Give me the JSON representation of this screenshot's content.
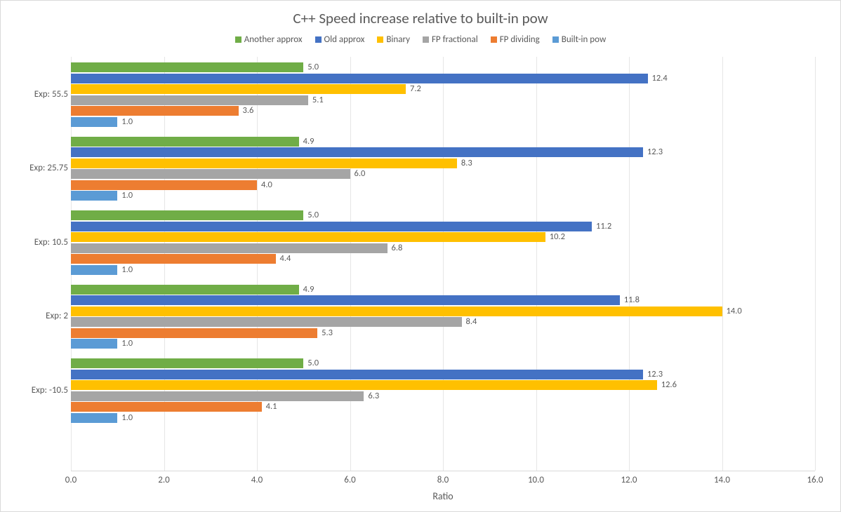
{
  "title": "C++ Speed increase relative to built-in pow",
  "xlabel": "Ratio",
  "legend_order": [
    "Another approx",
    "Old approx",
    "Binary",
    "FP fractional",
    "FP dividing",
    "Built-in pow"
  ],
  "chart_data": {
    "type": "bar",
    "orientation": "horizontal",
    "xlabel": "Ratio",
    "ylabel": "",
    "xlim": [
      0.0,
      16.0
    ],
    "xticks": [
      0.0,
      2.0,
      4.0,
      6.0,
      8.0,
      10.0,
      12.0,
      14.0,
      16.0
    ],
    "categories": [
      "Exp: -10.5",
      "Exp: 2",
      "Exp: 10.5",
      "Exp: 25.75",
      "Exp: 55.5"
    ],
    "series": [
      {
        "name": "Another approx",
        "color": "#70ad47",
        "values": [
          5.0,
          4.9,
          5.0,
          4.9,
          5.0
        ]
      },
      {
        "name": "Old approx",
        "color": "#4472c4",
        "values": [
          12.3,
          11.8,
          11.2,
          12.3,
          12.4
        ]
      },
      {
        "name": "Binary",
        "color": "#ffc000",
        "values": [
          12.6,
          14.0,
          10.2,
          8.3,
          7.2
        ]
      },
      {
        "name": "FP fractional",
        "color": "#a5a5a5",
        "values": [
          6.3,
          8.4,
          6.8,
          6.0,
          5.1
        ]
      },
      {
        "name": "FP dividing",
        "color": "#ed7d31",
        "values": [
          4.1,
          5.3,
          4.4,
          4.0,
          3.6
        ]
      },
      {
        "name": "Built-in pow",
        "color": "#5b9bd5",
        "values": [
          1.0,
          1.0,
          1.0,
          1.0,
          1.0
        ]
      }
    ]
  }
}
